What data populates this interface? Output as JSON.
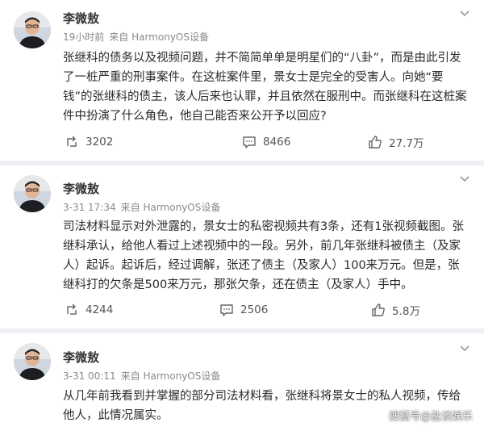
{
  "posts": [
    {
      "author": "李微敖",
      "time": "19小时前",
      "source": "来自 HarmonyOS设备",
      "content": "张继科的债务以及视频问题，并不简简单单是明星们的“八卦”，而是由此引发了一桩严重的刑事案件。在这桩案件里，景女士是完全的受害人。向她“要钱”的张继科的债主，该人后来也认罪，并且依然在服刑中。而张继科在这桩案件中扮演了什么角色，他自己能否来公开予以回应?",
      "reposts": "3202",
      "comments": "8466",
      "likes": "27.7万"
    },
    {
      "author": "李微敖",
      "time": "3-31 17:34",
      "source": "来自 HarmonyOS设备",
      "content": "司法材料显示对外泄露的，景女士的私密视频共有3条，还有1张视频截图。张继科承认，给他人看过上述视频中的一段。另外，前几年张继科被债主（及家人）起诉。起诉后，经过调解，张还了债主（及家人）100来万元。但是，张继科打的欠条是500来万元，那张欠条，还在债主（及家人）手中。",
      "reposts": "4244",
      "comments": "2506",
      "likes": "5.8万"
    },
    {
      "author": "李微敖",
      "time": "3-31 00:11",
      "source": "来自 HarmonyOS设备",
      "content": "从几年前我看到并掌握的部分司法材料看，张继科将景女士的私人视频，传给他人，此情况属实。"
    }
  ],
  "watermark": "搜狐号@盐谈娱乐"
}
